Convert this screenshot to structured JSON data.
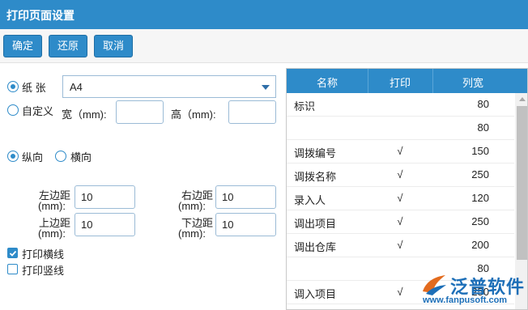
{
  "window": {
    "title": "打印页面设置"
  },
  "toolbar": {
    "ok_label": "确定",
    "restore_label": "还原",
    "cancel_label": "取消"
  },
  "paper": {
    "paper_label": "纸 张",
    "paper_value": "A4",
    "paper_selected": true,
    "custom_label": "自定义",
    "width_label": "宽（mm):",
    "height_label": "高（mm):",
    "width_value": "",
    "height_value": ""
  },
  "orientation": {
    "portrait_label": "纵向",
    "landscape_label": "横向",
    "selected": "portrait"
  },
  "margins": {
    "left_label_1": "左边距",
    "left_label_2": "(mm):",
    "left_value": "10",
    "right_label_1": "右边距",
    "right_label_2": "(mm):",
    "right_value": "10",
    "top_label_1": "上边距",
    "top_label_2": "(mm):",
    "top_value": "10",
    "bottom_label_1": "下边距",
    "bottom_label_2": "(mm):",
    "bottom_value": "10"
  },
  "options": {
    "print_hlines_label": "打印横线",
    "print_hlines_checked": true,
    "print_vlines_label": "打印竖线",
    "print_vlines_checked": false
  },
  "columns_table": {
    "headers": [
      "名称",
      "打印",
      "列宽"
    ],
    "rows": [
      {
        "name": "标识",
        "print": "",
        "width": "80"
      },
      {
        "name": "",
        "print": "",
        "width": "80"
      },
      {
        "name": "调拨编号",
        "print": "√",
        "width": "150"
      },
      {
        "name": "调拨名称",
        "print": "√",
        "width": "250"
      },
      {
        "name": "录入人",
        "print": "√",
        "width": "120"
      },
      {
        "name": "调出项目",
        "print": "√",
        "width": "250"
      },
      {
        "name": "调出仓库",
        "print": "√",
        "width": "200"
      },
      {
        "name": "",
        "print": "",
        "width": "80"
      },
      {
        "name": "调入项目",
        "print": "√",
        "width": "250"
      }
    ]
  },
  "watermark": {
    "brand": "泛普软件",
    "url": "www.fanpusoft.com"
  },
  "colors": {
    "accent": "#2e8bc9",
    "brand": "#1d6fb8"
  }
}
